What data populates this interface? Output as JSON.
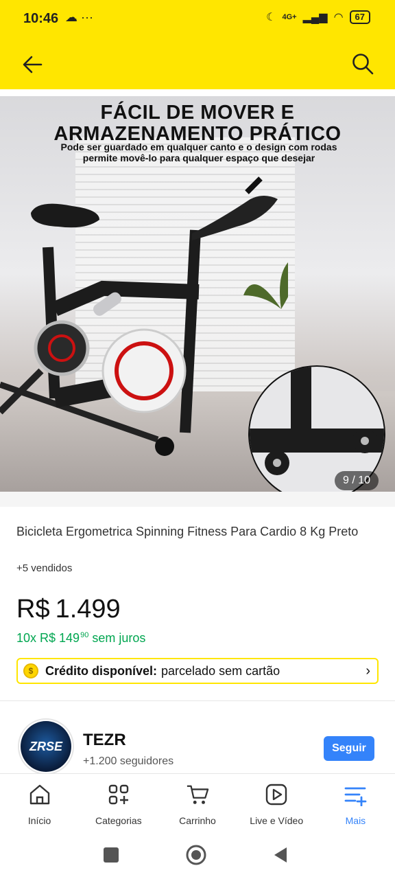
{
  "status_bar": {
    "time": "10:46",
    "left_icons": "☁ ···",
    "signal": "4G+",
    "battery": "67"
  },
  "header": {
    "back_icon": "arrow-left-icon",
    "search_icon": "search-icon"
  },
  "gallery": {
    "headline_line1": "FÁCIL DE MOVER E",
    "headline_line2": "ARMAZENAMENTO PRÁTICO",
    "subline": "Pode ser guardado em qualquer canto e o design com rodas permite movê-lo para qualquer espaço que desejar",
    "counter": "9 / 10"
  },
  "product": {
    "title": "Bicicleta Ergometrica Spinning Fitness Para Cardio 8 Kg Preto",
    "sold": "+5 vendidos",
    "currency": "R$",
    "price": "1.499",
    "installments_prefix": "10x R$ 149",
    "installments_cents": "90",
    "installments_suffix": "sem juros"
  },
  "credit": {
    "label_bold": "Crédito disponível:",
    "label": "parcelado sem cartão"
  },
  "seller": {
    "logo_text": "ZRSE",
    "name": "TEZR",
    "followers": "+1.200 seguidores",
    "follow_label": "Seguir"
  },
  "bottom_nav": {
    "items": [
      {
        "label": "Início",
        "icon": "home-icon"
      },
      {
        "label": "Categorias",
        "icon": "categories-icon"
      },
      {
        "label": "Carrinho",
        "icon": "cart-icon"
      },
      {
        "label": "Live e Vídeo",
        "icon": "play-icon"
      },
      {
        "label": "Mais",
        "icon": "menu-plus-icon"
      }
    ]
  },
  "colors": {
    "brand_yellow": "#ffe600",
    "accent_blue": "#3483fa",
    "installment_green": "#00a650"
  }
}
